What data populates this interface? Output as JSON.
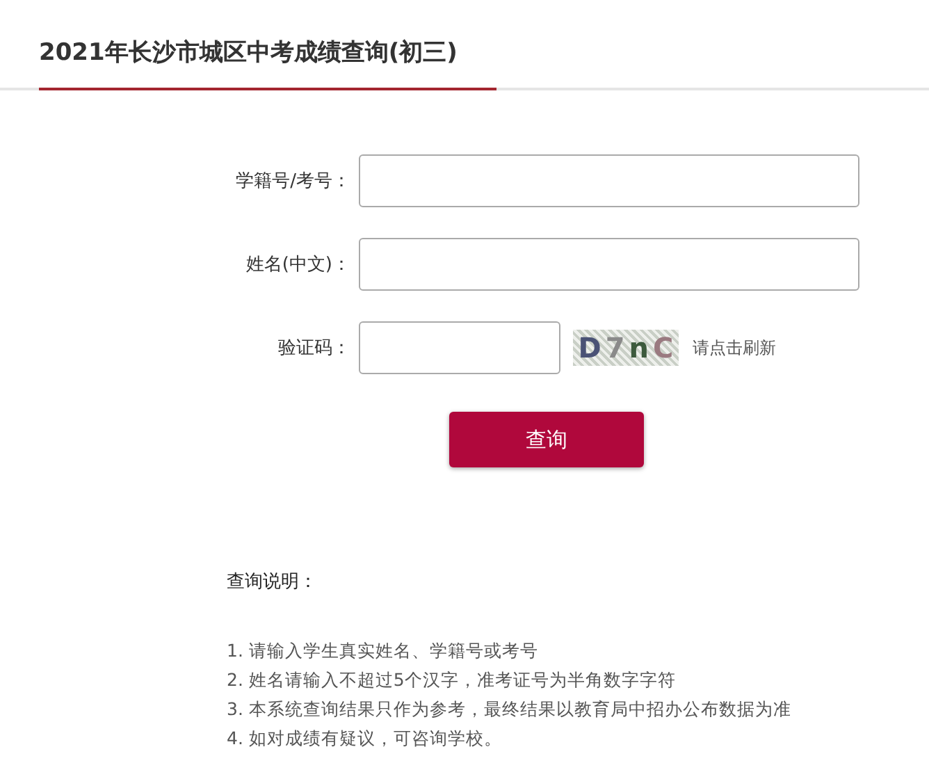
{
  "title": "2021年长沙市城区中考成绩查询(初三)",
  "fields": [
    {
      "kind": "text",
      "label": "学籍号/考号："
    },
    {
      "kind": "text",
      "label": "姓名(中文)："
    },
    {
      "kind": "captcha",
      "label": "验证码：",
      "captcha": "D7nC",
      "refresh": "请点击刷新"
    }
  ],
  "submit": "查询",
  "notes": {
    "heading": "查询说明：",
    "items": [
      "1. 请输入学生真实姓名、学籍号或考号",
      "2. 姓名请输入不超过5个汉字，准考证号为半角数字字符",
      "3. 本系统查询结果只作为参考，最终结果以教育局中招办公布数据为准",
      "4. 如对成绩有疑议，可咨询学校。"
    ]
  }
}
